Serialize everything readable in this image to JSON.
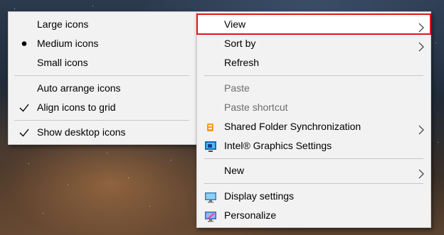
{
  "view_submenu": {
    "items": [
      {
        "label": "Large icons",
        "mark": ""
      },
      {
        "label": "Medium icons",
        "mark": "bullet"
      },
      {
        "label": "Small icons",
        "mark": ""
      },
      {
        "label": "Auto arrange icons",
        "mark": ""
      },
      {
        "label": "Align icons to grid",
        "mark": "check"
      },
      {
        "label": "Show desktop icons",
        "mark": "check"
      }
    ]
  },
  "context_menu": {
    "items": [
      {
        "label": "View",
        "submenu": true,
        "highlighted": true
      },
      {
        "label": "Sort by",
        "submenu": true
      },
      {
        "label": "Refresh"
      },
      {
        "label": "Paste",
        "disabled": true
      },
      {
        "label": "Paste shortcut",
        "disabled": true
      },
      {
        "label": "Shared Folder Synchronization",
        "submenu": true,
        "icon": "shared-folder-sync-icon"
      },
      {
        "label": "Intel® Graphics Settings",
        "icon": "intel-graphics-icon"
      },
      {
        "label": "New",
        "submenu": true
      },
      {
        "label": "Display settings",
        "icon": "display-settings-icon"
      },
      {
        "label": "Personalize",
        "icon": "personalize-icon"
      }
    ]
  },
  "colors": {
    "menu_background": "#f2f2f2",
    "highlight_border": "#e0161b",
    "disabled_text": "#6d6d6d"
  }
}
